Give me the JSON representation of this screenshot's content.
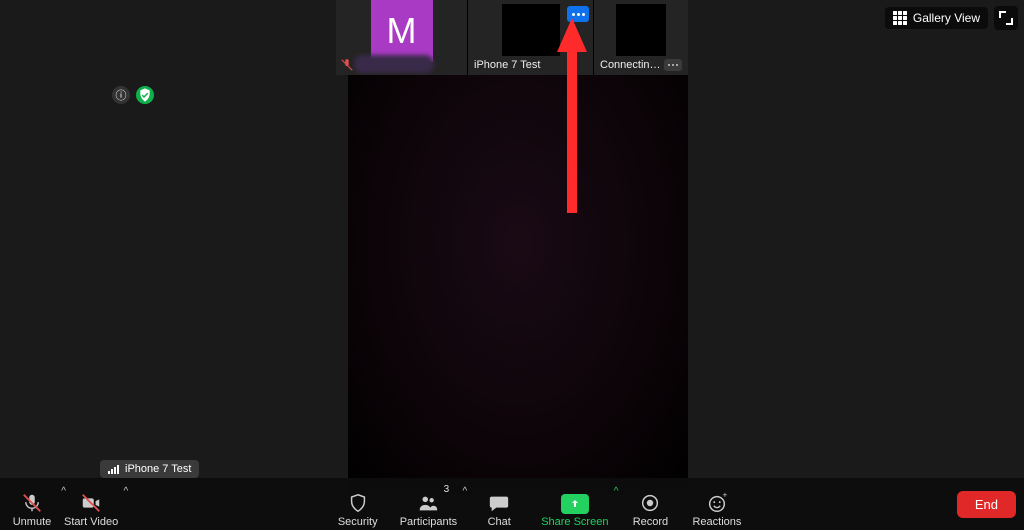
{
  "topbar": {
    "gallery_label": "Gallery View"
  },
  "participants": [
    {
      "name": "",
      "avatar_letter": "M",
      "muted": true
    },
    {
      "name": "iPhone 7 Test"
    },
    {
      "name": "Connecting t..."
    }
  ],
  "badges": {
    "info_glyph": "ⓘ"
  },
  "audio_source": {
    "label": "iPhone 7 Test"
  },
  "toolbar": {
    "unmute": "Unmute",
    "start_video": "Start Video",
    "security": "Security",
    "participants": "Participants",
    "participants_count": "3",
    "chat": "Chat",
    "share_screen": "Share Screen",
    "record": "Record",
    "reactions": "Reactions",
    "end": "End"
  },
  "colors": {
    "accent_green": "#23d160",
    "accent_blue": "#0e72ed",
    "danger": "#e02828",
    "avatar_purple": "#a93ac4"
  }
}
